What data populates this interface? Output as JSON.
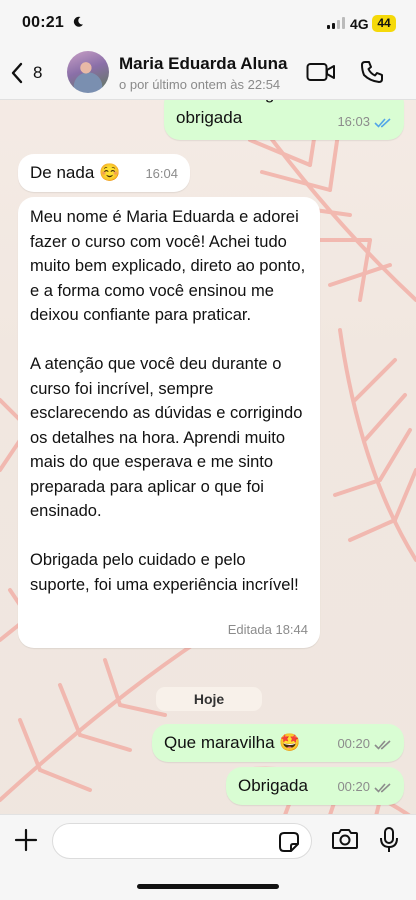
{
  "status_bar": {
    "time": "00:21",
    "network": "4G",
    "battery": "44",
    "icons": [
      "moon-icon",
      "signal-icon"
    ]
  },
  "header": {
    "back_count": "8",
    "contact_name": "Maria Eduarda Aluna",
    "last_seen": "o por último ontem às 22:54",
    "icons": [
      "chevron-left-icon",
      "video-call-icon",
      "phone-call-icon"
    ]
  },
  "messages": [
    {
      "direction": "out",
      "text": "Ta bom te aguardo então\nobrigada",
      "time": "16:03",
      "status": "read"
    },
    {
      "direction": "in",
      "text": "De nada ☺️",
      "time": "16:04"
    },
    {
      "direction": "in",
      "text": "Meu nome é Maria Eduarda e adorei fazer o curso com você! Achei tudo muito bem explicado, direto ao ponto, e a forma como você ensinou me deixou confiante para praticar.\n\n  A atenção que você deu durante o curso foi incrível, sempre esclarecendo as dúvidas e corrigindo os detalhes na hora. Aprendi muito mais do que esperava e me sinto preparada para aplicar o que foi ensinado.\n\n  Obrigada pelo cuidado e pelo suporte, foi uma experiência incrível!",
      "time": "Editada 18:44"
    },
    {
      "direction": "out",
      "text": "Que maravilha 🤩",
      "time": "00:20",
      "status": "delivered"
    },
    {
      "direction": "out",
      "text": "Obrigada",
      "time": "00:20",
      "status": "delivered"
    }
  ],
  "date_separator": "Hoje",
  "input_bar": {
    "value": "",
    "icons": [
      "plus-icon",
      "sticker-icon",
      "camera-icon",
      "microphone-icon"
    ]
  },
  "colors": {
    "outgoing_bubble": "#d9fdd3",
    "incoming_bubble": "#ffffff",
    "read_tick": "#53a6e8",
    "delivered_tick": "#8c8c8c",
    "battery": "#f5d90a"
  }
}
